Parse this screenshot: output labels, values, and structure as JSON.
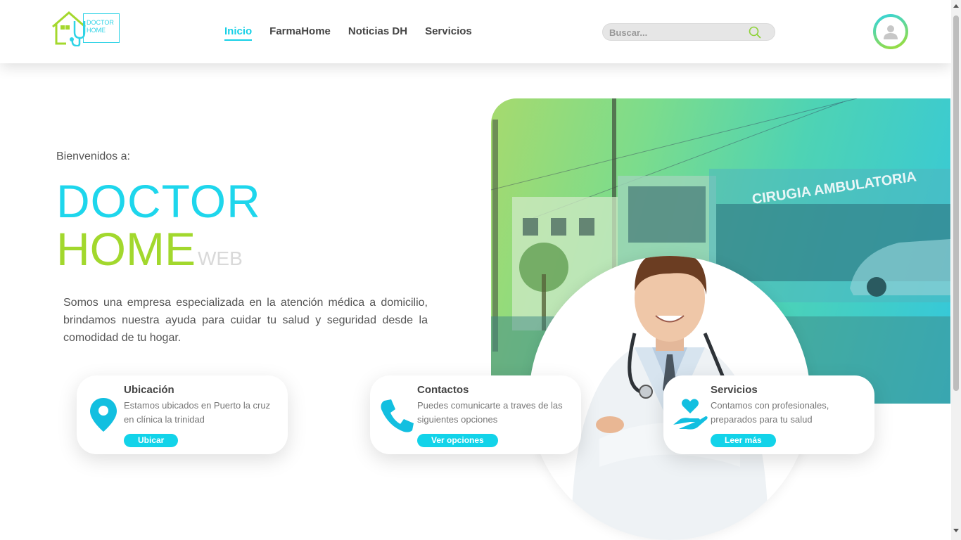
{
  "header": {
    "logo": {
      "line1": "DOCTOR",
      "line2": "HOME"
    },
    "nav": [
      "Inicio",
      "FarmaHome",
      "Noticias DH",
      "Servicios"
    ],
    "search_placeholder": "Buscar...",
    "icons": {
      "search": "search-icon",
      "avatar": "user-avatar-icon"
    }
  },
  "hero": {
    "welcome": "Bienvenidos a:",
    "title_line1": "DOCTOR",
    "title_line2": "HOME",
    "title_suffix": "WEB",
    "description": "Somos una empresa especializada en la atención médica a domicilio, brindamos nuestra ayuda para cuidar tu salud y seguridad desde la comodidad de tu hogar.",
    "photo_sign_1": "CIRUGIA AMBULATORIA",
    "photo_sign_2": "CIRUGIA AMBULATORIA"
  },
  "cards": [
    {
      "title": "Ubicación",
      "text": "Estamos ubicados en Puerto la cruz en clínica la trinidad",
      "button": "Ubicar",
      "icon": "location-pin-icon"
    },
    {
      "title": "Contactos",
      "text": "Puedes comunicarte a traves de las siguientes opciones",
      "button": "Ver opciones",
      "icon": "phone-icon"
    },
    {
      "title": "Servicios",
      "text": "Contamos con profesionales, preparados para tu salud",
      "button": "Leer más",
      "icon": "heart-hand-icon"
    }
  ],
  "colors": {
    "primary": "#17d0e6",
    "secondary": "#a2d82d",
    "text": "#444444"
  }
}
